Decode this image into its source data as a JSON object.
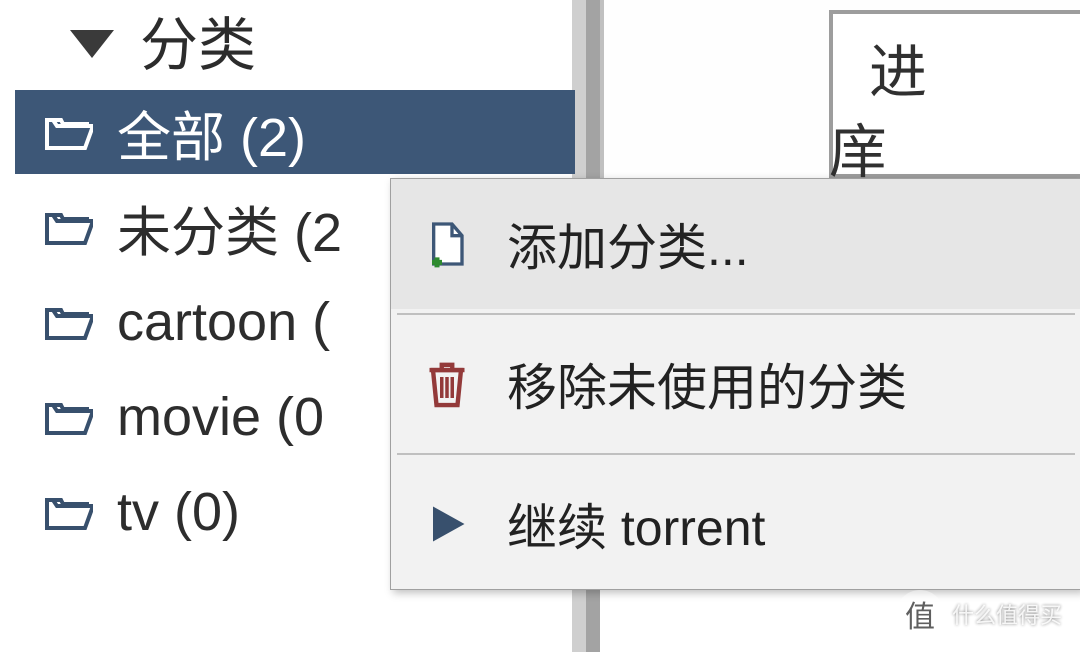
{
  "sidebar": {
    "group_label": "分类",
    "items": [
      {
        "label": "全部 (2)",
        "selected": true
      },
      {
        "label": "未分类 (2",
        "selected": false
      },
      {
        "label": "cartoon (",
        "selected": false
      },
      {
        "label": "movie (0",
        "selected": false
      },
      {
        "label": "tv (0)",
        "selected": false
      }
    ]
  },
  "detail": {
    "line1": "进",
    "line2": "庠"
  },
  "context_menu": {
    "items": [
      {
        "label": "添加分类...",
        "icon": "add-file-icon"
      },
      {
        "label": "移除未使用的分类",
        "icon": "trash-icon"
      },
      {
        "label": "继续 torrent",
        "icon": "play-icon"
      }
    ]
  },
  "watermark": {
    "badge": "值",
    "text": "什么值得买"
  }
}
